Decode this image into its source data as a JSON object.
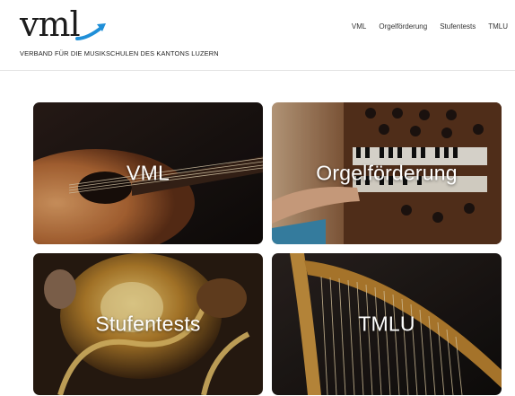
{
  "brand": {
    "logo_text": "vml",
    "tagline": "VERBAND FÜR DIE MUSIKSCHULEN DES KANTONS LUZERN",
    "accent_color": "#1f8fd8"
  },
  "nav": {
    "items": [
      {
        "label": "VML"
      },
      {
        "label": "Orgelförderung"
      },
      {
        "label": "Stufentests"
      },
      {
        "label": "TMLU"
      }
    ]
  },
  "tiles": [
    {
      "label": "VML",
      "image": "acoustic-guitar"
    },
    {
      "label": "Orgelförderung",
      "image": "organ-keyboard"
    },
    {
      "label": "Stufentests",
      "image": "brass-tuba"
    },
    {
      "label": "TMLU",
      "image": "harp-strings"
    }
  ]
}
